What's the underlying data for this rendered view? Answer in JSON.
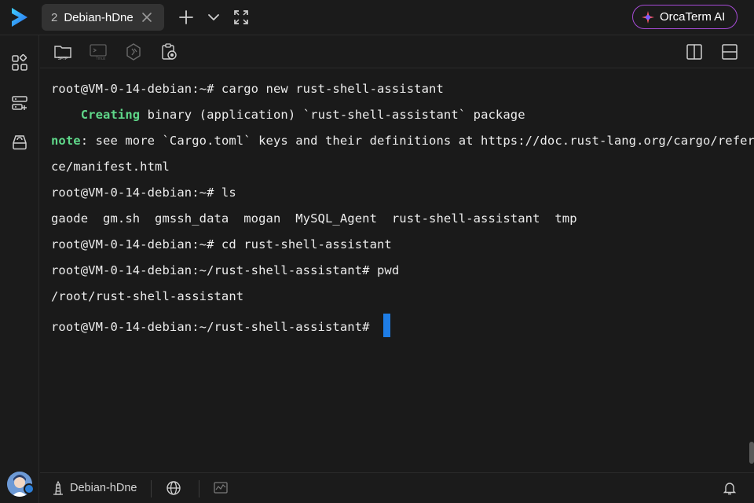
{
  "tab": {
    "number": "2",
    "title": "Debian-hDne"
  },
  "ai_button": {
    "label": "OrcaTerm AI"
  },
  "icons": {
    "logo": "orcaterm-logo-icon",
    "close": "close-icon",
    "add": "plus-icon",
    "dropdown": "chevron-down-icon",
    "fullscreen": "fullscreen-icon",
    "ai": "ai-sparkle-icon",
    "sidebar": [
      "apps-icon",
      "server-list-icon",
      "cloud-drive-icon"
    ],
    "toolbar": [
      "sftp-icon",
      "tmux-icon",
      "extension-icon",
      "clipboard-record-icon",
      "split-vertical-icon",
      "split-horizontal-icon"
    ],
    "status": [
      "host-icon",
      "globe-icon",
      "monitor-icon",
      "bell-icon"
    ]
  },
  "toolbar": {
    "sftp_label": "SFTP",
    "tmux_label": "Tmux"
  },
  "terminal": {
    "lines": [
      {
        "text": "root@VM-0-14-debian:~# cargo new rust-shell-assistant"
      },
      {
        "prefix": "    ",
        "highlight": "Creating",
        "text": " binary (application) `rust-shell-assistant` package"
      },
      {
        "highlight": "note",
        "text": ": see more `Cargo.toml` keys and their definitions at https://doc.rust-lang.org/cargo/referen"
      },
      {
        "text": "ce/manifest.html"
      },
      {
        "text": "root@VM-0-14-debian:~# ls"
      },
      {
        "text": "gaode  gm.sh  gmssh_data  mogan  MySQL_Agent  rust-shell-assistant  tmp"
      },
      {
        "text": "root@VM-0-14-debian:~# cd rust-shell-assistant"
      },
      {
        "text": "root@VM-0-14-debian:~/rust-shell-assistant# pwd"
      },
      {
        "text": "/root/rust-shell-assistant"
      },
      {
        "text": "root@VM-0-14-debian:~/rust-shell-assistant# ",
        "cursor": true
      }
    ]
  },
  "status": {
    "host_label": "Debian-hDne"
  },
  "colors": {
    "accent": "#1e7de6",
    "highlight": "#5fd789",
    "ai_border": "#a64bd6"
  }
}
